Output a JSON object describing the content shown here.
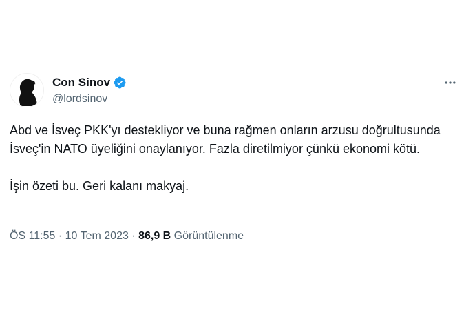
{
  "author": {
    "display_name": "Con Sinov",
    "handle": "@lordsinov",
    "verified": true,
    "verified_color": "#1d9bf0",
    "avatar_icon": "silhouette-portrait-icon"
  },
  "tweet": {
    "paragraph_1": "Abd ve İsveç PKK'yı destekliyor ve buna rağmen onların arzusu doğrultusunda İsveç'in NATO üyeliğini onaylanıyor. Fazla diretilmiyor çünkü ekonomi kötü.",
    "paragraph_2": "İşin özeti bu. Geri kalanı makyaj."
  },
  "meta": {
    "time": "ÖS 11:55",
    "separator_1": " · ",
    "date": "10 Tem 2023",
    "separator_2": " · ",
    "views_count": "86,9 B",
    "views_label": " Görüntülenme"
  },
  "icons": {
    "more": "more-dots-icon",
    "verified": "verified-badge-icon"
  }
}
